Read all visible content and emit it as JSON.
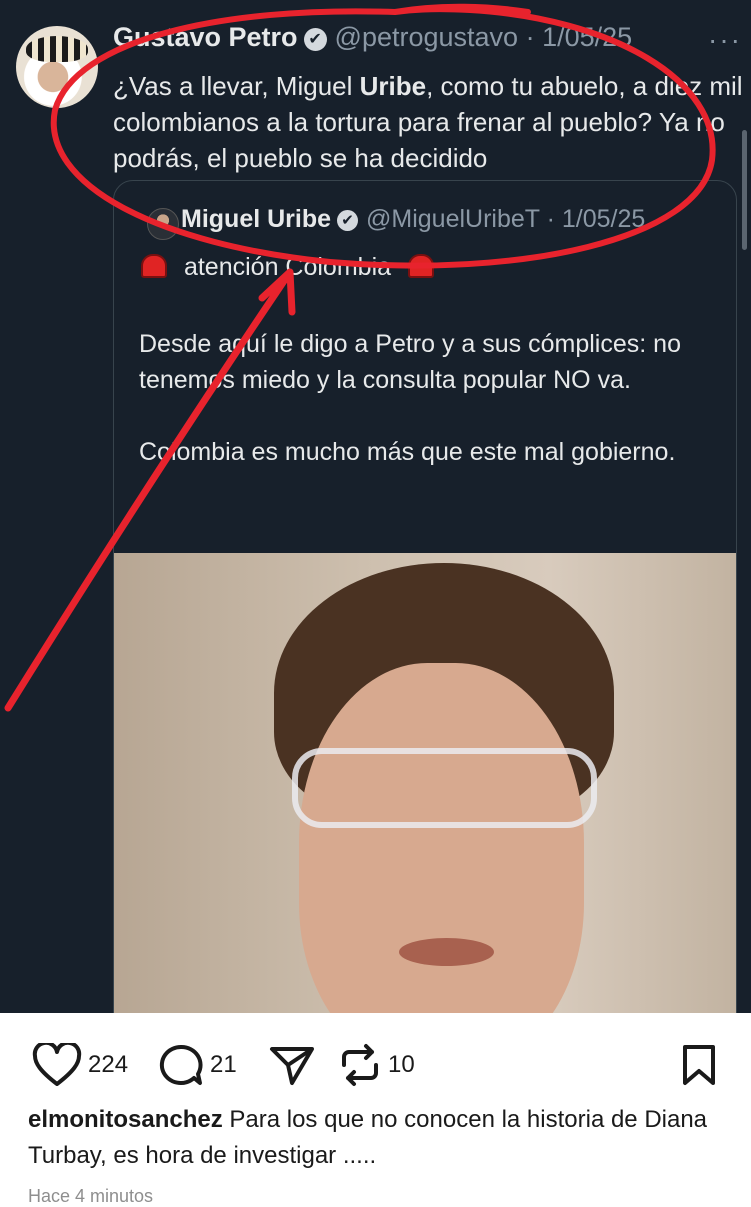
{
  "tweet": {
    "author_name": "Gustavo Petro",
    "verified_icon": "✔",
    "handle": "@petrogustavo",
    "separator": "·",
    "date": "1/05/25",
    "more": "···",
    "text_1": "¿Vas a llevar, Miguel ",
    "text_bold": "Uribe",
    "text_2": ", como tu abuelo, a diez mil colombianos a la tortura para frenar al pueblo? Ya no podrás, el pueblo se ha decidido"
  },
  "quote": {
    "author_name": "Miguel Uribe",
    "handle": "@MiguelUribeT",
    "separator": "·",
    "date": "1/05/25",
    "alert_text": "atención Colombia",
    "body_1": "Desde aquí le digo a Petro y a sus cómplices: no tenemos miedo y la consulta popular NO va.",
    "body_2": "Colombia es mucho más que este mal gobierno."
  },
  "post": {
    "likes": "224",
    "comments": "21",
    "reposts": "10",
    "caption_user": "elmonitosanchez",
    "caption_text": " Para los que no conocen la historia de Diana Turbay, es hora de investigar .....",
    "time": "Hace 4 minutos"
  },
  "colors": {
    "tweet_bg": "#17202b",
    "annotation_red": "#e8232d"
  }
}
